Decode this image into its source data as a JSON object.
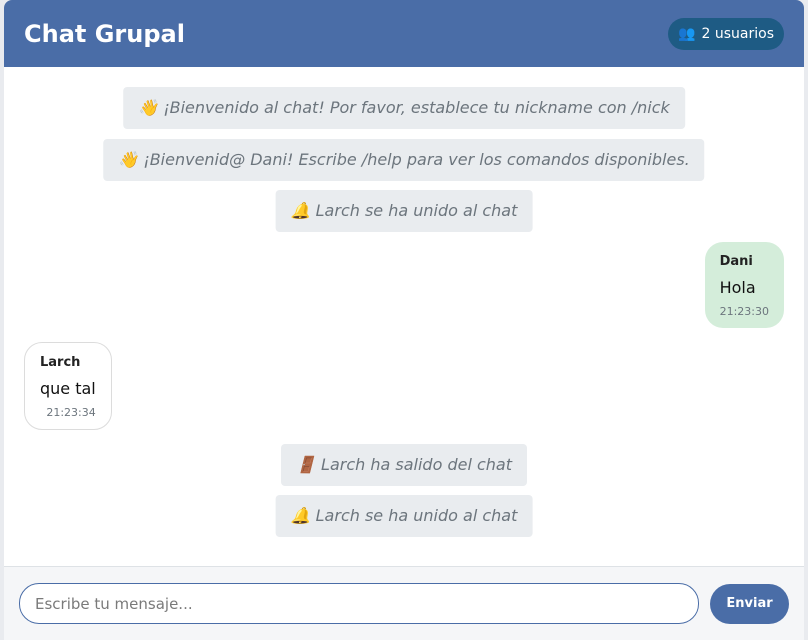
{
  "header": {
    "title": "Chat Grupal",
    "users_icon": "users-icon",
    "users_icon_glyph": "👥",
    "users_label": "2 usuarios"
  },
  "messages": {
    "sys1": {
      "icon": "wave-icon",
      "glyph": "👋",
      "text": "¡Bienvenido al chat! Por favor, establece tu nickname con /nick"
    },
    "sys2": {
      "icon": "wave-icon",
      "glyph": "👋",
      "text": "¡Bienvenid@ Dani! Escribe /help para ver los comandos disponibles."
    },
    "sys3": {
      "icon": "bell-icon",
      "glyph": "🔔",
      "text": "Larch se ha unido al chat"
    },
    "own1": {
      "sender": "Dani",
      "text": "Hola",
      "time": "21:23:30"
    },
    "other1": {
      "sender": "Larch",
      "text": "que tal",
      "time": "21:23:34"
    },
    "sys4": {
      "icon": "door-icon",
      "glyph": "🚪",
      "text": "Larch ha salido del chat"
    },
    "sys5": {
      "icon": "bell-icon",
      "glyph": "🔔",
      "text": "Larch se ha unido al chat"
    }
  },
  "composer": {
    "placeholder": "Escribe tu mensaje...",
    "value": "",
    "send_label": "Enviar"
  },
  "colors": {
    "header": "#4a6da7",
    "badge": "#1e5b84",
    "own_bubble": "#d4edda",
    "system_bg": "#e9ecef",
    "accent": "#4a6da7"
  }
}
